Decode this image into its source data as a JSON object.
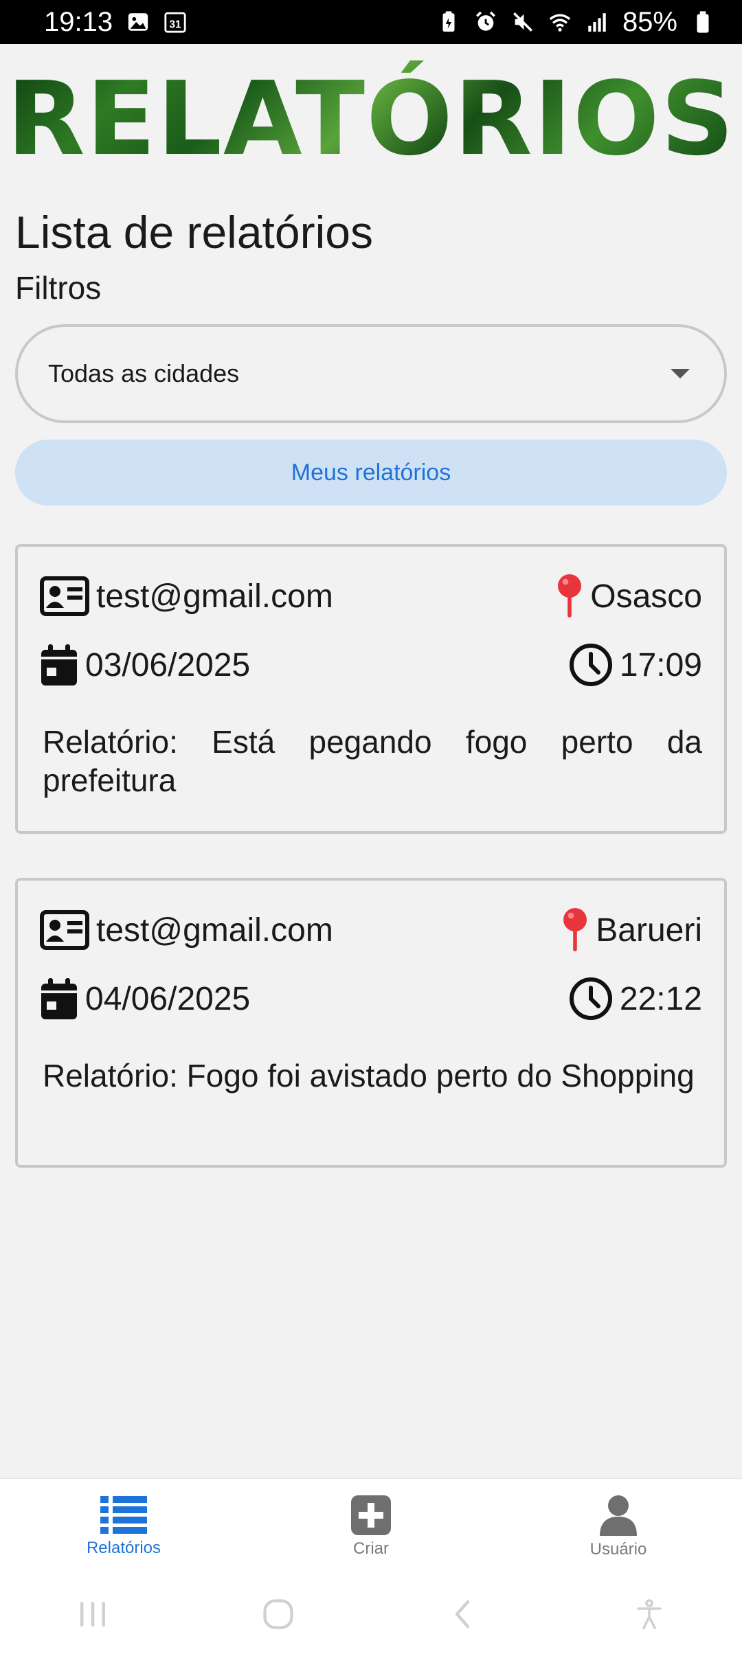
{
  "status_bar": {
    "time": "19:13",
    "calendar_day": "31",
    "battery": "85%"
  },
  "page": {
    "title": "RELATÓRIOS",
    "list_title": "Lista de relatórios",
    "filters_label": "Filtros"
  },
  "filters": {
    "city_select_value": "Todas as cidades",
    "my_reports_label": "Meus relatórios"
  },
  "reports": [
    {
      "email": "test@gmail.com",
      "city": "Osasco",
      "date": "03/06/2025",
      "time": "17:09",
      "text": "Relatório: Está pegando fogo perto da prefeitura"
    },
    {
      "email": "test@gmail.com",
      "city": "Barueri",
      "date": "04/06/2025",
      "time": "22:12",
      "text": "Relatório: Fogo foi avistado perto do Shopping"
    }
  ],
  "bottom_nav": {
    "items": [
      {
        "label": "Relatórios",
        "icon": "list-icon",
        "active": true
      },
      {
        "label": "Criar",
        "icon": "plus-square-icon",
        "active": false
      },
      {
        "label": "Usuário",
        "icon": "user-icon",
        "active": false
      }
    ]
  },
  "colors": {
    "accent": "#1e73d8",
    "pin": "#e8343b",
    "button_bg": "#cfe1f5",
    "title_green": "#2f7a24"
  }
}
